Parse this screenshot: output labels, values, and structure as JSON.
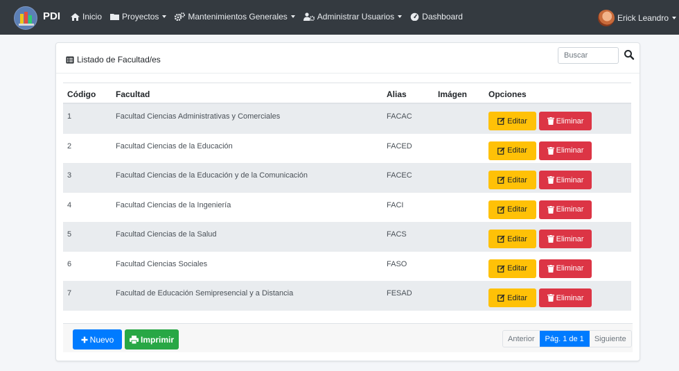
{
  "navbar": {
    "brand": "PDI",
    "items": [
      {
        "label": "Inicio",
        "icon": "home-icon",
        "dropdown": false
      },
      {
        "label": "Proyectos",
        "icon": "folder-icon",
        "dropdown": true
      },
      {
        "label": "Mantenimientos Generales",
        "icon": "cogs-icon",
        "dropdown": true
      },
      {
        "label": "Administrar Usuarios",
        "icon": "users-cog-icon",
        "dropdown": true
      },
      {
        "label": "Dashboard",
        "icon": "tachometer-icon",
        "dropdown": false
      }
    ],
    "user": "Erick Leandro"
  },
  "card": {
    "title": "Listado de Facultad/es",
    "search_placeholder": "Buscar"
  },
  "table": {
    "headers": [
      "Código",
      "Facultad",
      "Alias",
      "Imágen",
      "Opciones"
    ],
    "rows": [
      {
        "code": "1",
        "faculty": "Facultad Ciencias Administrativas y Comerciales",
        "alias": "FACAC"
      },
      {
        "code": "2",
        "faculty": "Facultad Ciencias de la Educación",
        "alias": "FACED"
      },
      {
        "code": "3",
        "faculty": "Facultad Ciencias de la Educación y de la Comunicación",
        "alias": "FACEC"
      },
      {
        "code": "4",
        "faculty": "Facultad Ciencias de la Ingeniería",
        "alias": "FACI"
      },
      {
        "code": "5",
        "faculty": "Facultad Ciencias de la Salud",
        "alias": "FACS"
      },
      {
        "code": "6",
        "faculty": "Facultad Ciencias Sociales",
        "alias": "FASO"
      },
      {
        "code": "7",
        "faculty": "Facultad de Educación Semipresencial y a Distancia",
        "alias": "FESAD"
      }
    ],
    "edit_label": "Editar",
    "delete_label": "Eliminar"
  },
  "footer": {
    "new_label": "Nuevo",
    "print_label": "Imprimir",
    "pager": {
      "prev": "Anterior",
      "current": "Pág. 1 de 1",
      "next": "Siguiente"
    }
  },
  "colors": {
    "navbar": "#343a40",
    "edit": "#ffc107",
    "delete": "#dc3545",
    "primary": "#007bff",
    "success": "#28a745"
  }
}
